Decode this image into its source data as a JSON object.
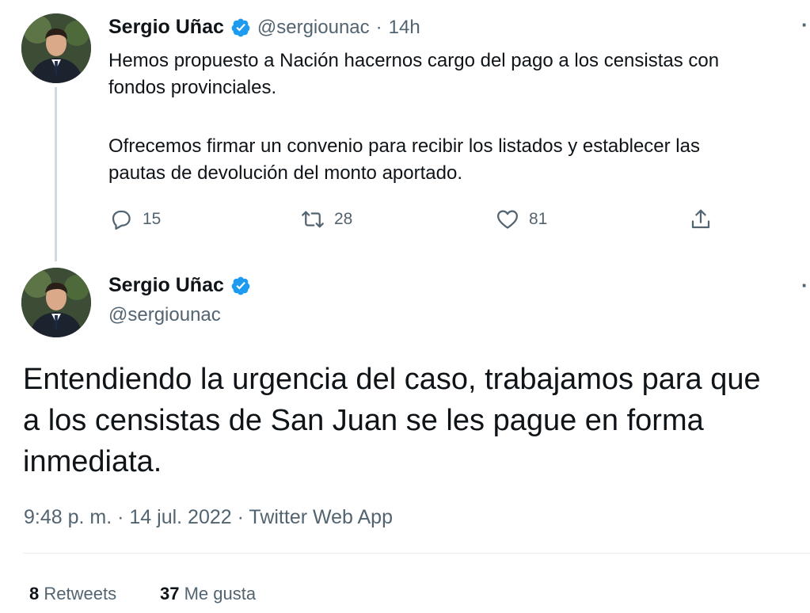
{
  "reply_tweet": {
    "author_name": "Sergio Uñac",
    "handle": "@sergiounac",
    "separator": "·",
    "time": "14h",
    "lines": [
      "Hemos propuesto a Nación hacernos cargo del pago a los censistas con",
      "fondos provinciales.",
      "Ofrecemos firmar un convenio para recibir los listados y establecer las",
      "pautas de devolución del monto aportado."
    ],
    "actions": {
      "replies": "15",
      "retweets": "28",
      "likes": "81"
    },
    "icons": [
      "reply-icon",
      "retweet-icon",
      "like-icon",
      "share-icon"
    ]
  },
  "main_tweet": {
    "author_name": "Sergio Uñac",
    "handle": "@sergiounac",
    "lines": [
      "Entendiendo la urgencia del caso, trabajamos para que",
      "a los censistas de San Juan se les pague en forma",
      "inmediata."
    ],
    "meta": "9:48 p. m. · 14 jul. 2022 · Twitter Web App",
    "stats": {
      "retweets_count": "8",
      "retweets_label": "Retweets",
      "likes_count": "37",
      "likes_label": "Me gusta"
    }
  },
  "colors": {
    "verified": "#1d9bf0",
    "secondary_text": "#536471",
    "primary_text": "#0f1419",
    "thread_line": "#cfd9de"
  }
}
